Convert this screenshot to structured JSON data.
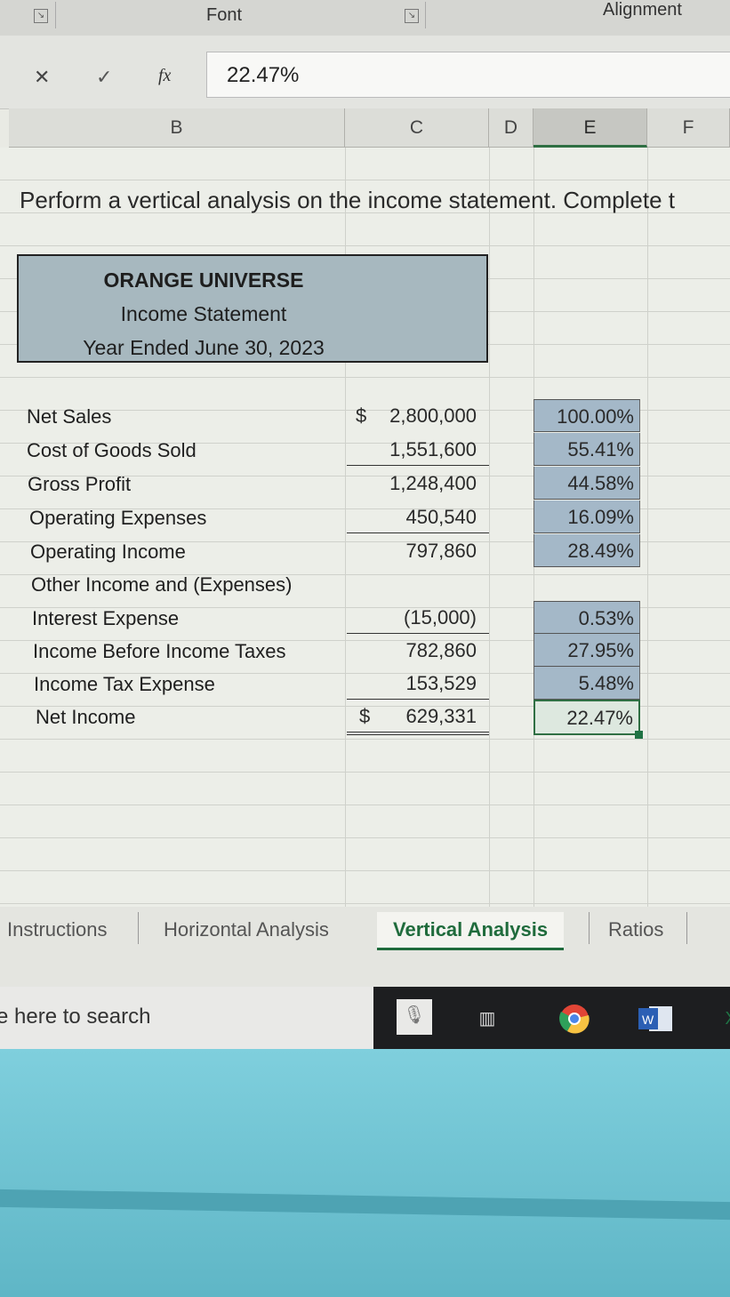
{
  "ribbon": {
    "font_label": "Font",
    "alignment_label": "Alignment"
  },
  "formula_bar": {
    "cancel": "✕",
    "enter": "✓",
    "fx": "fx",
    "value": "22.47%"
  },
  "columns": [
    "B",
    "C",
    "D",
    "E",
    "F"
  ],
  "instruction": "Perform a vertical analysis on the income statement. Complete t",
  "title": {
    "company": "ORANGE UNIVERSE",
    "statement": "Income Statement",
    "period": "Year Ended June 30, 2023"
  },
  "rows": [
    {
      "label": "Net Sales",
      "dollar": "$",
      "amount": "2,800,000",
      "pct": "100.00%"
    },
    {
      "label": "Cost of Goods Sold",
      "dollar": "",
      "amount": "1,551,600",
      "pct": "55.41%"
    },
    {
      "label": "Gross Profit",
      "dollar": "",
      "amount": "1,248,400",
      "pct": "44.58%"
    },
    {
      "label": "Operating Expenses",
      "dollar": "",
      "amount": "450,540",
      "pct": "16.09%"
    },
    {
      "label": "Operating Income",
      "dollar": "",
      "amount": "797,860",
      "pct": "28.49%"
    },
    {
      "label": "Other Income and (Expenses)",
      "dollar": "",
      "amount": "",
      "pct": ""
    },
    {
      "label": "Interest Expense",
      "dollar": "",
      "amount": "(15,000)",
      "pct": "0.53%"
    },
    {
      "label": "Income Before Income Taxes",
      "dollar": "",
      "amount": "782,860",
      "pct": "27.95%"
    },
    {
      "label": "Income Tax Expense",
      "dollar": "",
      "amount": "153,529",
      "pct": "5.48%"
    },
    {
      "label": "Net Income",
      "dollar": "$",
      "amount": "629,331",
      "pct": "22.47%"
    }
  ],
  "sheet_tabs": [
    "Instructions",
    "Horizontal Analysis",
    "Vertical Analysis",
    "Ratios"
  ],
  "taskbar": {
    "search_placeholder": "e here to search"
  }
}
